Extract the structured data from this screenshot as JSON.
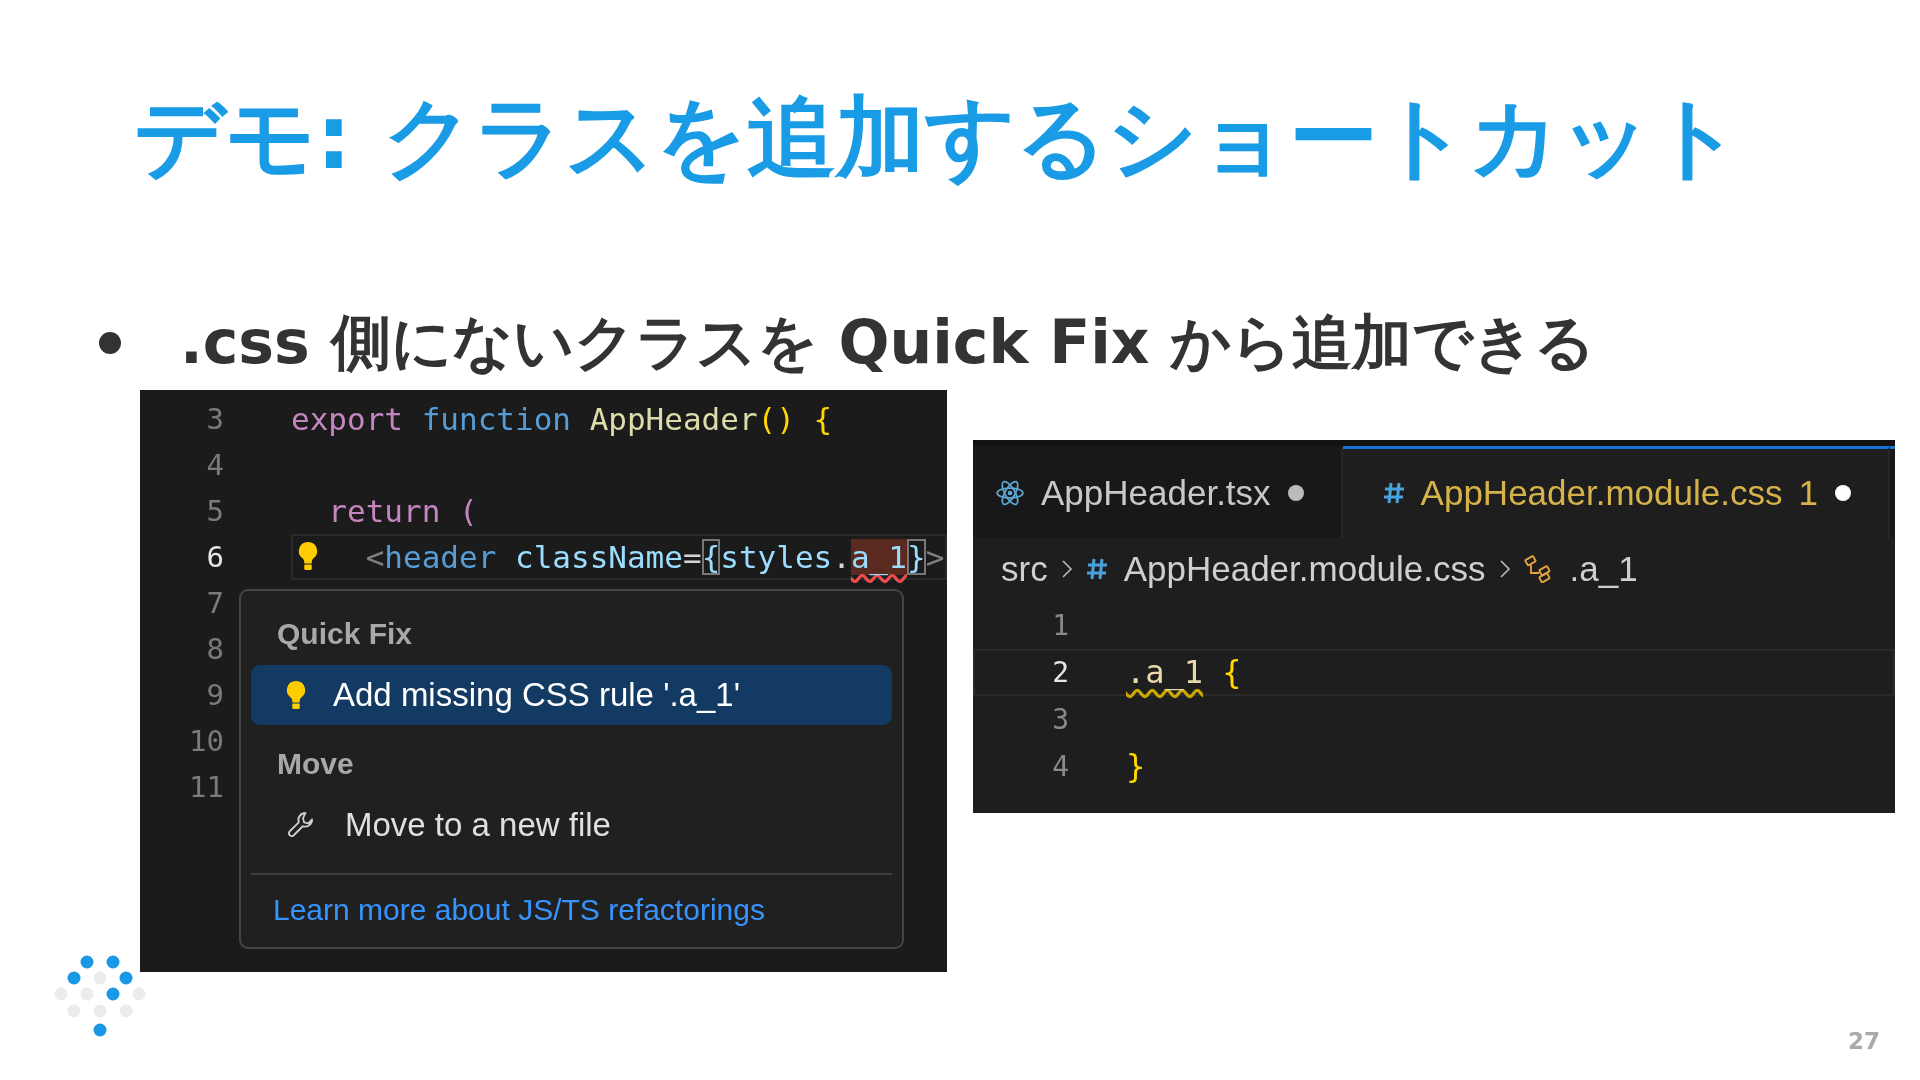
{
  "slide": {
    "title": "デモ: クラスを追加するショートカット",
    "bullets": [
      ".css 側にないクラスを Quick Fix から追加できる"
    ],
    "page_number": "27"
  },
  "left_editor": {
    "lines": [
      {
        "number": "3",
        "current": false,
        "tokens": [
          {
            "text": "export",
            "kind": "keyword"
          },
          {
            "text": " function",
            "kind": "storage"
          },
          {
            "text": " AppHeader",
            "kind": "function"
          },
          {
            "text": "()",
            "kind": "paren"
          },
          {
            "text": " {",
            "kind": "paren"
          }
        ]
      },
      {
        "number": "4",
        "current": false
      },
      {
        "number": "5",
        "current": false,
        "tokens": [
          {
            "text": "  return",
            "kind": "keyword"
          },
          {
            "text": " (",
            "kind": "keyword"
          }
        ]
      },
      {
        "number": "6",
        "current": true,
        "lightbulb": true,
        "tokens": [
          {
            "text": "    <",
            "kind": "punct"
          },
          {
            "text": "header",
            "kind": "tag"
          },
          {
            "text": " className",
            "kind": "attr"
          },
          {
            "text": "=",
            "kind": "plain"
          },
          {
            "text": "{",
            "kind": "bracket_match"
          },
          {
            "text": "styles",
            "kind": "attr"
          },
          {
            "text": ".",
            "kind": "plain"
          },
          {
            "text": "a_1",
            "kind": "error"
          },
          {
            "text": "}",
            "kind": "bracket_match"
          },
          {
            "text": ">",
            "kind": "punct"
          }
        ]
      },
      {
        "number": "7",
        "current": false
      },
      {
        "number": "8",
        "current": false
      },
      {
        "number": "9",
        "current": false
      },
      {
        "number": "10",
        "current": false
      },
      {
        "number": "11",
        "current": false
      }
    ],
    "quick_fix_menu": {
      "sections": [
        {
          "heading": "Quick Fix",
          "items": [
            {
              "label": "Add missing CSS rule '.a_1'",
              "kind": "fix",
              "selected": true
            }
          ]
        },
        {
          "heading": "Move",
          "items": [
            {
              "label": "Move to a new file",
              "kind": "refactor",
              "selected": false
            }
          ]
        }
      ],
      "link": "Learn more about JS/TS refactorings"
    }
  },
  "right_editor": {
    "tabs": [
      {
        "label": "AppHeader.tsx",
        "kind": "tsx",
        "selected": false,
        "modified": true
      },
      {
        "label": "AppHeader.module.css",
        "kind": "css",
        "selected": true,
        "problems": "1",
        "modified": true
      }
    ],
    "breadcrumbs": [
      {
        "label": "src",
        "kind": "folder"
      },
      {
        "label": "AppHeader.module.css",
        "kind": "css"
      },
      {
        "label": ".a_1",
        "kind": "selector"
      }
    ],
    "lines": [
      {
        "number": "1",
        "current": false
      },
      {
        "number": "2",
        "current": true,
        "tokens": [
          {
            "text": ".a_1",
            "kind": "warning"
          },
          {
            "text": " {",
            "kind": "paren"
          }
        ]
      },
      {
        "number": "3",
        "current": false
      },
      {
        "number": "4",
        "current": false,
        "tokens": [
          {
            "text": "}",
            "kind": "paren"
          }
        ]
      }
    ]
  }
}
